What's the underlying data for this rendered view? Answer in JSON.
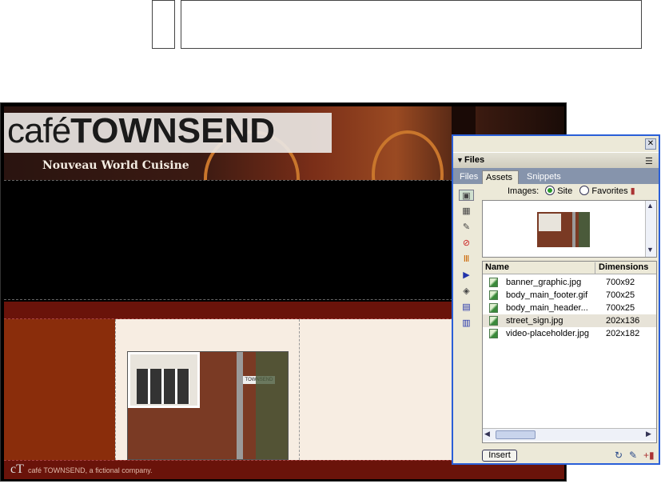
{
  "canvas": {
    "logo_light": "café",
    "logo_bold": "TOWNSEND",
    "tagline": "Nouveau World Cuisine",
    "footer_logo": "cT",
    "footer_text": "café TOWNSEND, a fictional company.",
    "sign_text": "TOWNSEND"
  },
  "panel": {
    "title": "Files",
    "tabs": [
      "Files",
      "Assets",
      "Snippets"
    ],
    "images_label": "Images:",
    "radio_site": "Site",
    "radio_favorites": "Favorites",
    "columns": {
      "name": "Name",
      "dimensions": "Dimensions"
    },
    "rows": [
      {
        "name": "banner_graphic.jpg",
        "dim": "700x92"
      },
      {
        "name": "body_main_footer.gif",
        "dim": "700x25"
      },
      {
        "name": "body_main_header...",
        "dim": "700x25"
      },
      {
        "name": "street_sign.jpg",
        "dim": "202x136"
      },
      {
        "name": "video-placeholder.jpg",
        "dim": "202x182"
      }
    ],
    "insert_label": "Insert"
  }
}
